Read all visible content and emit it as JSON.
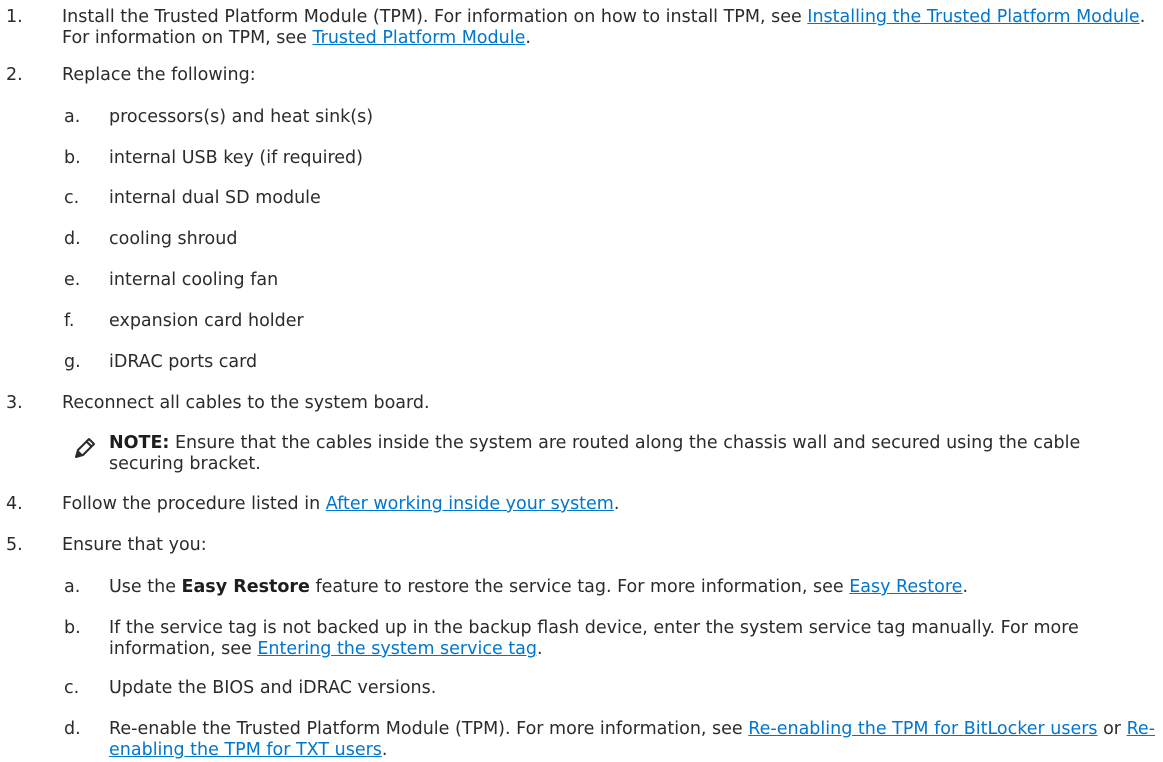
{
  "steps": [
    {
      "num": "1.",
      "text_a": "Install the Trusted Platform Module (TPM). For information on how to install TPM, see ",
      "link_a": "Installing the Trusted Platform Module",
      "text_b": ". For information on TPM, see ",
      "link_b": "Trusted Platform Module",
      "text_c": "."
    },
    {
      "num": "2.",
      "text": "Replace the following:",
      "subs": [
        {
          "letter": "a.",
          "text": "processors(s) and heat sink(s)"
        },
        {
          "letter": "b.",
          "text": "internal USB key (if required)"
        },
        {
          "letter": "c.",
          "text": "internal dual SD module"
        },
        {
          "letter": "d.",
          "text": "cooling shroud"
        },
        {
          "letter": "e.",
          "text": "internal cooling fan"
        },
        {
          "letter": "f.",
          "text": "expansion card holder"
        },
        {
          "letter": "g.",
          "text": "iDRAC ports card"
        }
      ]
    },
    {
      "num": "3.",
      "text": "Reconnect all cables to the system board.",
      "note_label": "NOTE:",
      "note_text": " Ensure that the cables inside the system are routed along the chassis wall and secured using the cable securing bracket."
    },
    {
      "num": "4.",
      "text_a": "Follow the procedure listed in ",
      "link": "After working inside your system",
      "text_b": "."
    },
    {
      "num": "5.",
      "text": "Ensure that you:",
      "subs": [
        {
          "letter": "a.",
          "text_a": "Use the ",
          "bold": "Easy Restore",
          "text_b": " feature to restore the service tag. For more information, see ",
          "link": "Easy Restore",
          "text_c": "."
        },
        {
          "letter": "b.",
          "text_a": "If the service tag is not backed up in the backup flash device, enter the system service tag manually. For more information, see ",
          "link": "Entering the system service tag",
          "text_b": "."
        },
        {
          "letter": "c.",
          "text": "Update the BIOS and iDRAC versions."
        },
        {
          "letter": "d.",
          "text_a": "Re-enable the Trusted Platform Module (TPM). For more information, see ",
          "link_a": "Re-enabling the TPM for BitLocker users",
          "text_b": " or ",
          "link_b": "Re-enabling the TPM for TXT users",
          "text_c": "."
        }
      ]
    }
  ],
  "icons": {
    "note": "pencil-note-icon"
  },
  "colors": {
    "link": "#0076ce",
    "text": "#2b2b2b"
  }
}
